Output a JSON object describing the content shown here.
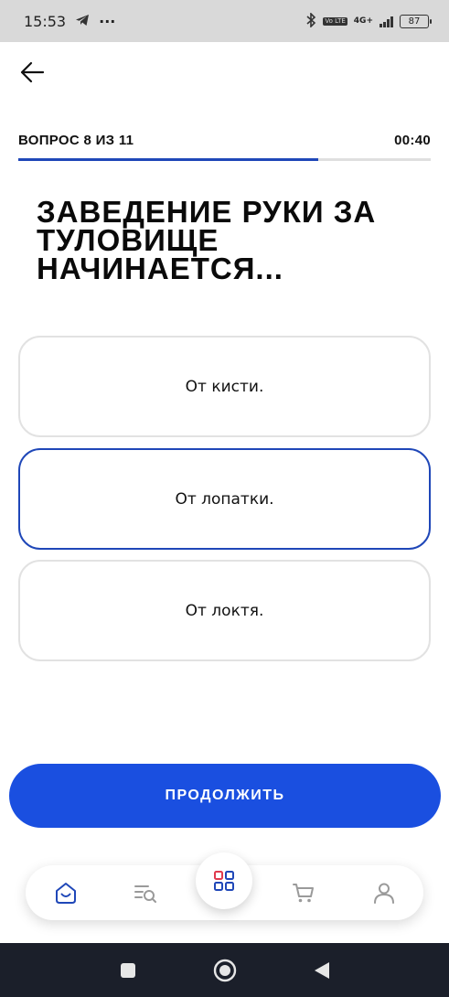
{
  "status_bar": {
    "time": "15:53",
    "more": "···",
    "network": "4G+",
    "volte": "Vo LTE",
    "battery": "87"
  },
  "quiz": {
    "progress_label": "ВОПРОС 8 ИЗ 11",
    "timer": "00:40",
    "progress_fraction": 0.727,
    "question": "ЗАВЕДЕНИЕ РУКИ ЗА ТУЛОВИЩЕ НАЧИНАЕТСЯ...",
    "answers": [
      {
        "label": "От кисти.",
        "selected": false
      },
      {
        "label": "От лопатки.",
        "selected": true
      },
      {
        "label": "От локтя.",
        "selected": false
      }
    ],
    "continue_label": "ПРОДОЛЖИТЬ"
  },
  "colors": {
    "accent": "#1a4fe0",
    "selected_border": "#1f47b8",
    "progress": "#1f47b8"
  },
  "bottom_nav": {
    "items": [
      "home-icon",
      "search-list-icon",
      "grid-icon",
      "cart-icon",
      "profile-icon"
    ]
  }
}
